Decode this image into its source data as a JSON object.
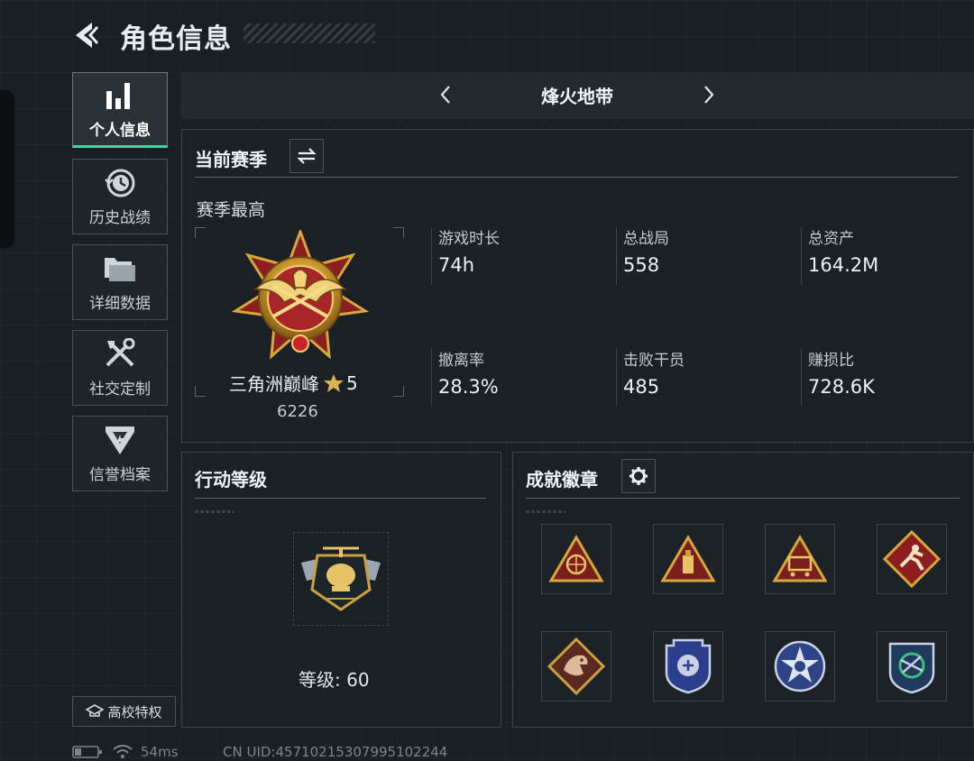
{
  "header": {
    "title": "角色信息"
  },
  "sidebar": {
    "items": [
      {
        "label": "个人信息",
        "icon": "bar-chart-icon"
      },
      {
        "label": "历史战绩",
        "icon": "history-clock-icon"
      },
      {
        "label": "详细数据",
        "icon": "folders-icon"
      },
      {
        "label": "社交定制",
        "icon": "tools-icon"
      },
      {
        "label": "信誉档案",
        "icon": "shield-emblem-icon"
      }
    ],
    "school_button": "高校特权"
  },
  "season_selector": {
    "name": "烽火地带"
  },
  "season_panel": {
    "title": "当前赛季",
    "subtitle": "赛季最高",
    "rank_name": "三角洲巅峰",
    "rank_stars": "5",
    "rank_points": "6226",
    "stats": [
      {
        "label": "游戏时长",
        "value": "74h"
      },
      {
        "label": "总战局",
        "value": "558"
      },
      {
        "label": "总资产",
        "value": "164.2M"
      },
      {
        "label": "撤离率",
        "value": "28.3%"
      },
      {
        "label": "击败干员",
        "value": "485"
      },
      {
        "label": "赚损比",
        "value": "728.6K"
      }
    ]
  },
  "level_panel": {
    "title": "行动等级",
    "level_label": "等级:",
    "level_value": "60"
  },
  "badges_panel": {
    "title": "成就徽章",
    "badges": [
      "globe-triangle-badge-icon",
      "usb-triangle-badge-icon",
      "cart-triangle-badge-icon",
      "runner-diamond-badge-icon",
      "dragon-diamond-badge-icon",
      "police-shield-badge-icon",
      "skull-star-badge-icon",
      "circuit-shield-badge-icon"
    ]
  },
  "status_bar": {
    "ping": "54ms",
    "uid": "CN UID:45710215307995102244"
  },
  "colors": {
    "accent": "#3ed6a0",
    "gold": "#d4a83a",
    "crimson": "#8c1e22"
  }
}
